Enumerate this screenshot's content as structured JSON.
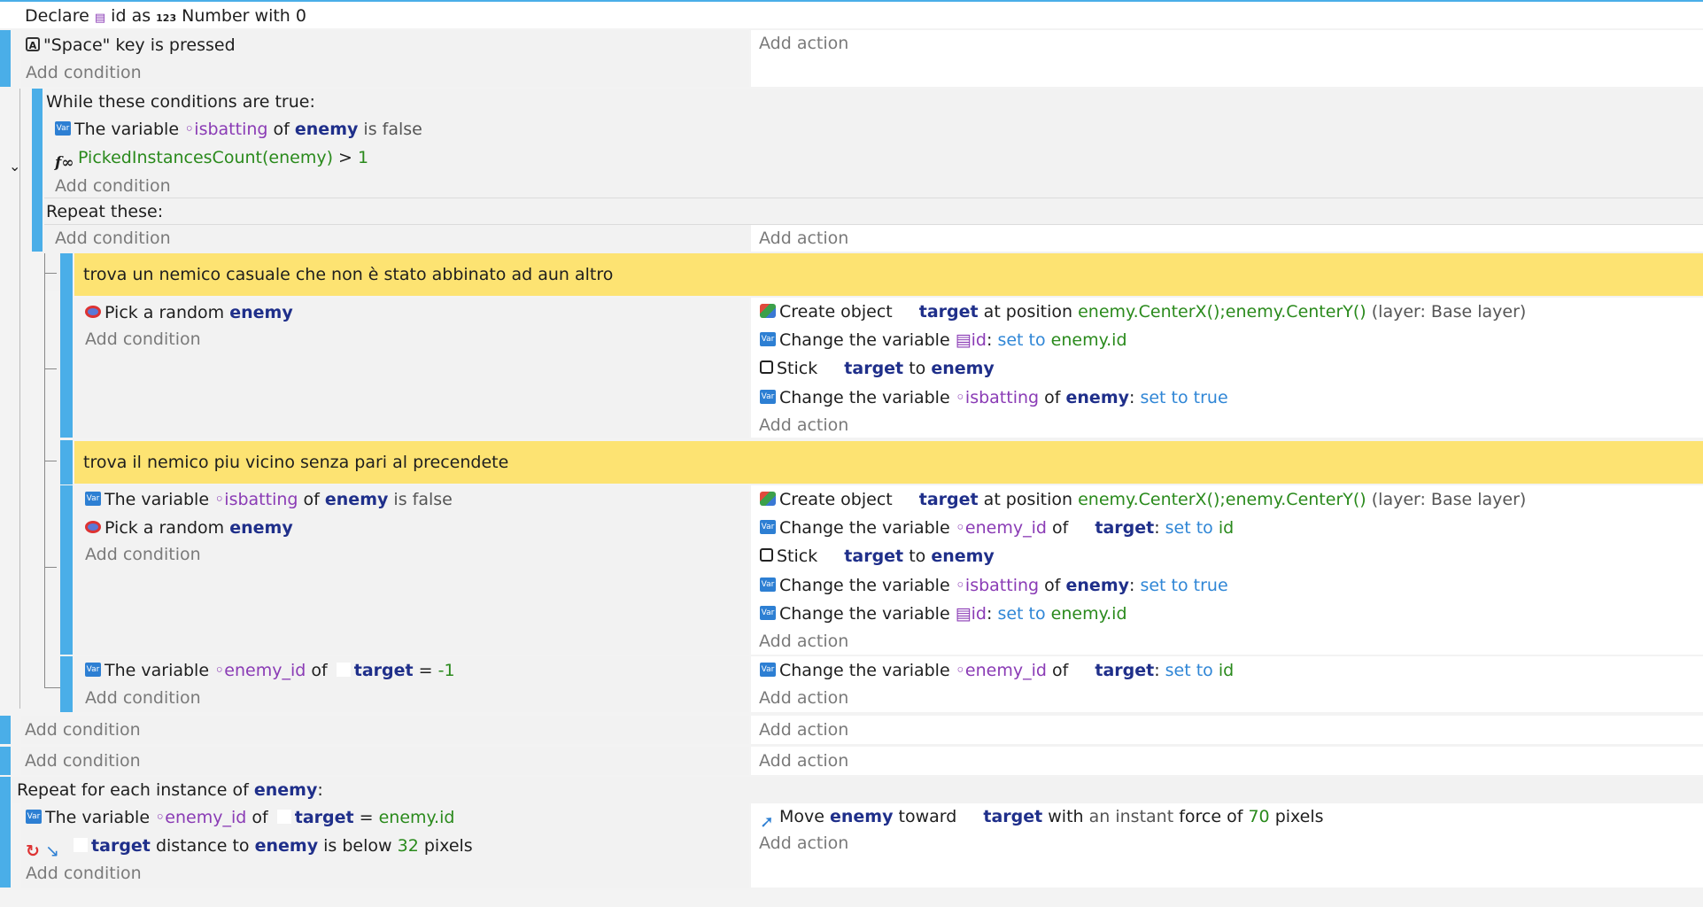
{
  "declare": {
    "text1": "Declare",
    "var": "id",
    "text2": "as",
    "type_icon": "123",
    "text3": "Number with 0"
  },
  "event1": {
    "cond_key": "A",
    "cond_text": "\"Space\" key is pressed",
    "add_condition": "Add condition",
    "add_action": "Add action"
  },
  "while": {
    "header": "While these conditions are true:",
    "cond1": {
      "pre": "The variable",
      "var": "isbatting",
      "of": "of",
      "obj": "enemy",
      "post": "is false"
    },
    "cond2": {
      "expr": "PickedInstancesCount(enemy)",
      "op": ">",
      "val": "1"
    },
    "add_condition": "Add condition",
    "repeat": "Repeat these:",
    "add_condition2": "Add condition",
    "add_action": "Add action"
  },
  "comment1": "trova un nemico casuale che non è stato abbinato ad aun altro",
  "sub1": {
    "cond": {
      "pre": "Pick a random",
      "obj": "enemy"
    },
    "add_condition": "Add condition",
    "a1": {
      "pre": "Create object",
      "obj": "target",
      "mid": "at position",
      "expr": "enemy.CenterX();enemy.CenterY()",
      "post": "(layer: Base layer)"
    },
    "a2": {
      "pre": "Change the variable",
      "var": "id",
      "colon": ":",
      "set": "set to",
      "val": "enemy.id"
    },
    "a3": {
      "pre": "Stick",
      "obj": "target",
      "mid": "to",
      "obj2": "enemy"
    },
    "a4": {
      "pre": "Change the variable",
      "var": "isbatting",
      "of": "of",
      "obj": "enemy",
      "colon": ":",
      "set": "set to true"
    },
    "add_action": "Add action"
  },
  "comment2": "trova il nemico piu vicino senza pari al precendete",
  "sub2": {
    "c1": {
      "pre": "The variable",
      "var": "isbatting",
      "of": "of",
      "obj": "enemy",
      "post": "is false"
    },
    "c2": {
      "pre": "Pick a random",
      "obj": "enemy"
    },
    "add_condition": "Add condition",
    "a1": {
      "pre": "Create object",
      "obj": "target",
      "mid": "at position",
      "expr": "enemy.CenterX();enemy.CenterY()",
      "post": "(layer: Base layer)"
    },
    "a2": {
      "pre": "Change the variable",
      "var": "enemy_id",
      "of": "of",
      "obj": "target",
      "colon": ":",
      "set": "set to",
      "val": "id"
    },
    "a3": {
      "pre": "Stick",
      "obj": "target",
      "mid": "to",
      "obj2": "enemy"
    },
    "a4": {
      "pre": "Change the variable",
      "var": "isbatting",
      "of": "of",
      "obj": "enemy",
      "colon": ":",
      "set": "set to true"
    },
    "a5": {
      "pre": "Change the variable",
      "var": "id",
      "colon": ":",
      "set": "set to",
      "val": "enemy.id"
    },
    "add_action": "Add action"
  },
  "sub3": {
    "c1": {
      "pre": "The variable",
      "var": "enemy_id",
      "of": "of",
      "obj": "target",
      "op": "=",
      "val": "-1"
    },
    "add_condition": "Add condition",
    "a1": {
      "pre": "Change the variable",
      "var": "enemy_id",
      "of": "of",
      "obj": "target",
      "colon": ":",
      "set": "set to",
      "val": "id"
    },
    "add_action": "Add action"
  },
  "empty1": {
    "add_condition": "Add condition",
    "add_action": "Add action"
  },
  "empty2": {
    "add_condition": "Add condition",
    "add_action": "Add action"
  },
  "foreach": {
    "header_pre": "Repeat for each instance of",
    "obj": "enemy",
    "header_post": ":",
    "c1": {
      "pre": "The variable",
      "var": "enemy_id",
      "of": "of",
      "obj": "target",
      "op": "=",
      "val": "enemy.id"
    },
    "c2": {
      "obj": "target",
      "mid": "distance to",
      "obj2": "enemy",
      "mid2": "is below",
      "val": "32",
      "post": "pixels"
    },
    "add_condition": "Add condition",
    "a1": {
      "pre": "Move",
      "obj": "enemy",
      "mid": "toward",
      "obj2": "target",
      "mid2": "with",
      "mid3": "an instant",
      "mid4": "force of",
      "val": "70",
      "post": "pixels"
    },
    "add_action": "Add action"
  },
  "icons": {
    "var": "Var",
    "collapse": "chevron-down-icon"
  }
}
